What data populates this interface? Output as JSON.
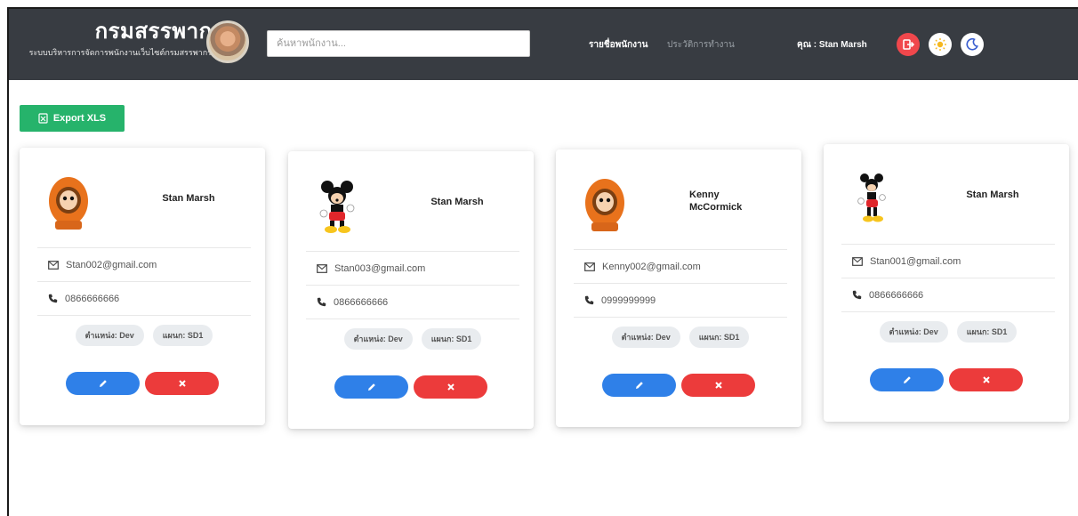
{
  "brand": {
    "title": "กรมสรรพากร",
    "subtitle": "ระบบบริหารการจัดการพนักงานเว็บไซต์กรมสรรพากร"
  },
  "header": {
    "search_placeholder": "ค้นหาพนักงาน...",
    "nav_employees": "รายชื่อพนักงาน",
    "nav_reports": "ประวัติการทำงาน",
    "user_label": "คุณ : Stan Marsh"
  },
  "toolbar": {
    "export_label": "Export XLS"
  },
  "colors": {
    "navbar": "#383c42",
    "export": "#26b36b",
    "edit": "#2f80e8",
    "delete": "#ec3b3b",
    "logout": "#f0474c"
  },
  "employees": [
    {
      "name": "Stan Marsh",
      "avatar": "kenny-avatar",
      "email": "Stan002@gmail.com",
      "phone": "0866666666",
      "position": "ตำแหน่ง: Dev",
      "department": "แผนก: SD1"
    },
    {
      "name": "Stan Marsh",
      "avatar": "mickey-avatar",
      "email": "Stan003@gmail.com",
      "phone": "0866666666",
      "position": "ตำแหน่ง: Dev",
      "department": "แผนก: SD1"
    },
    {
      "name": "Kenny McCormick",
      "avatar": "kenny-avatar",
      "email": "Kenny002@gmail.com",
      "phone": "0999999999",
      "position": "ตำแหน่ง: Dev",
      "department": "แผนก: SD1"
    },
    {
      "name": "Stan Marsh",
      "avatar": "mickey-avatar",
      "email": "Stan001@gmail.com",
      "phone": "0866666666",
      "position": "ตำแหน่ง: Dev",
      "department": "แผนก: SD1"
    }
  ]
}
